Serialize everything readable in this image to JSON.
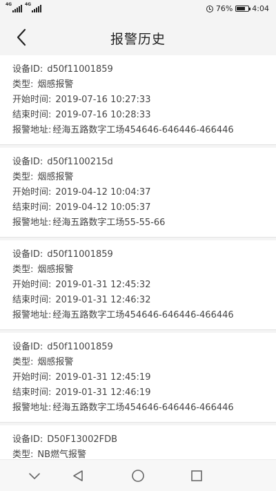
{
  "status_bar": {
    "signal1_label": "4G",
    "signal2_label": "4G",
    "battery_percent": "76%",
    "battery_level": 0.76,
    "time": "4:04"
  },
  "header": {
    "title": "报警历史"
  },
  "labels": {
    "device_id": "设备ID:",
    "type": "类型:",
    "start_time": "开始时间:",
    "end_time": "结束时间:",
    "address": "报警地址:"
  },
  "records": [
    {
      "device_id": "d50f11001859",
      "type": "烟感报警",
      "start_time": "2019-07-16 10:27:33",
      "end_time": "2019-07-16 10:28:33",
      "address": "经海五路数字工场454646-646446-466446"
    },
    {
      "device_id": "d50f1100215d",
      "type": "烟感报警",
      "start_time": "2019-04-12 10:04:37",
      "end_time": "2019-04-12 10:05:37",
      "address": "经海五路数字工场55-55-66"
    },
    {
      "device_id": "d50f11001859",
      "type": "烟感报警",
      "start_time": "2019-01-31 12:45:32",
      "end_time": "2019-01-31 12:46:32",
      "address": "经海五路数字工场454646-646446-466446"
    },
    {
      "device_id": "d50f11001859",
      "type": "烟感报警",
      "start_time": "2019-01-31 12:45:19",
      "end_time": "2019-01-31 12:46:19",
      "address": "经海五路数字工场454646-646446-466446"
    },
    {
      "device_id": "D50F13002FDB",
      "type": "NB燃气报警",
      "start_time": "",
      "end_time": "",
      "address": ""
    }
  ],
  "icons": {
    "back": "back-arrow-icon",
    "alarm": "alarm-clock-icon",
    "battery": "battery-icon",
    "nav_collapse": "chevron-down-icon",
    "nav_back": "triangle-back-icon",
    "nav_home": "circle-home-icon",
    "nav_recents": "square-recents-icon"
  }
}
